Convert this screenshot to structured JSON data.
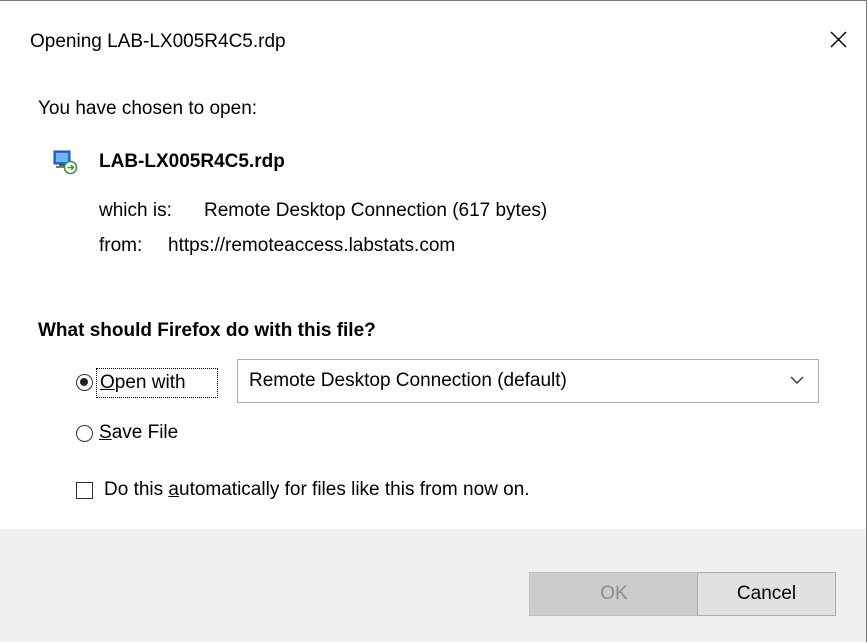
{
  "window": {
    "title": "Opening LAB-LX005R4C5.rdp"
  },
  "intro": "You have chosen to open:",
  "file": {
    "name": "LAB-LX005R4C5.rdp",
    "icon": "remote-desktop-file-icon",
    "type_label": "which is:",
    "type_value": "Remote Desktop Connection (617 bytes)",
    "from_label": "from:",
    "from_value": "https://remoteaccess.labstats.com"
  },
  "question": "What should Firefox do with this file?",
  "options": {
    "open_with": {
      "accel": "O",
      "label_rest": "pen with",
      "checked": true
    },
    "save_file": {
      "accel": "S",
      "label_rest": "ave File",
      "checked": false
    },
    "open_with_app": "Remote Desktop Connection (default)",
    "auto_prefix": "Do this ",
    "auto_accel": "a",
    "auto_suffix": "utomatically for files like this from now on.",
    "auto_checked": false
  },
  "buttons": {
    "ok": "OK",
    "cancel": "Cancel"
  },
  "colors": {
    "footer_bg": "#f0f0f0",
    "ok_disabled_bg": "#cccccc",
    "cancel_bg": "#e1e1e1"
  }
}
